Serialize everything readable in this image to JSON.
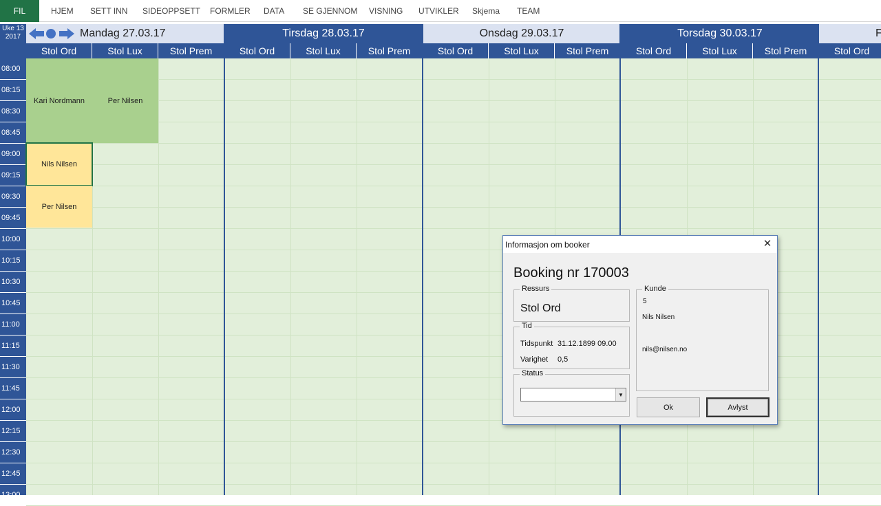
{
  "ribbon": {
    "file_tab": "FIL",
    "tabs": [
      "HJEM",
      "SETT INN",
      "SIDEOPPSETT",
      "FORMLER",
      "DATA",
      "SE GJENNOM",
      "VISNING",
      "UTVIKLER",
      "Skjema",
      "TEAM"
    ]
  },
  "calendar": {
    "week_label": "Uke 13",
    "year_label": "2017",
    "days": [
      "Mandag 27.03.17",
      "Tirsdag 28.03.17",
      "Onsdag 29.03.17",
      "Torsdag 30.03.17",
      "F"
    ],
    "resources": [
      "Stol Ord",
      "Stol Lux",
      "Stol Prem"
    ],
    "times": [
      "08:00",
      "08:15",
      "08:30",
      "08:45",
      "09:00",
      "09:15",
      "09:30",
      "09:45",
      "10:00",
      "10:15",
      "10:30",
      "10:45",
      "11:00",
      "11:15",
      "11:30",
      "11:45",
      "12:00",
      "12:15",
      "12:30",
      "12:45",
      "13:00"
    ],
    "bookings": [
      {
        "name": "Kari Nordmann",
        "color": "#a9d08e"
      },
      {
        "name": "Per Nilsen",
        "color": "#a9d08e"
      },
      {
        "name": "Nils Nilsen",
        "color": "#ffe699"
      },
      {
        "name": "Per Nilsen",
        "color": "#ffe699"
      }
    ],
    "colors": {
      "header_dark": "#2f5597",
      "header_light": "#dbe2f1",
      "cell_bg": "#e2efda",
      "excel_green": "#217346"
    }
  },
  "dialog": {
    "title": "Informasjon om booker",
    "booking_nr": "Booking nr 170003",
    "ressurs_legend": "Ressurs",
    "ressurs_value": "Stol Ord",
    "tid_legend": "Tid",
    "tidspunkt_label": "Tidspunkt",
    "tidspunkt_value": "31.12.1899 09.00",
    "varighet_label": "Varighet",
    "varighet_value": "0,5",
    "status_legend": "Status",
    "status_value": "",
    "kunde_legend": "Kunde",
    "kunde_id": "5",
    "kunde_name": "Nils Nilsen",
    "kunde_email": "nils@nilsen.no",
    "ok_label": "Ok",
    "cancel_label": "Avlyst",
    "close_icon": "close-icon"
  }
}
